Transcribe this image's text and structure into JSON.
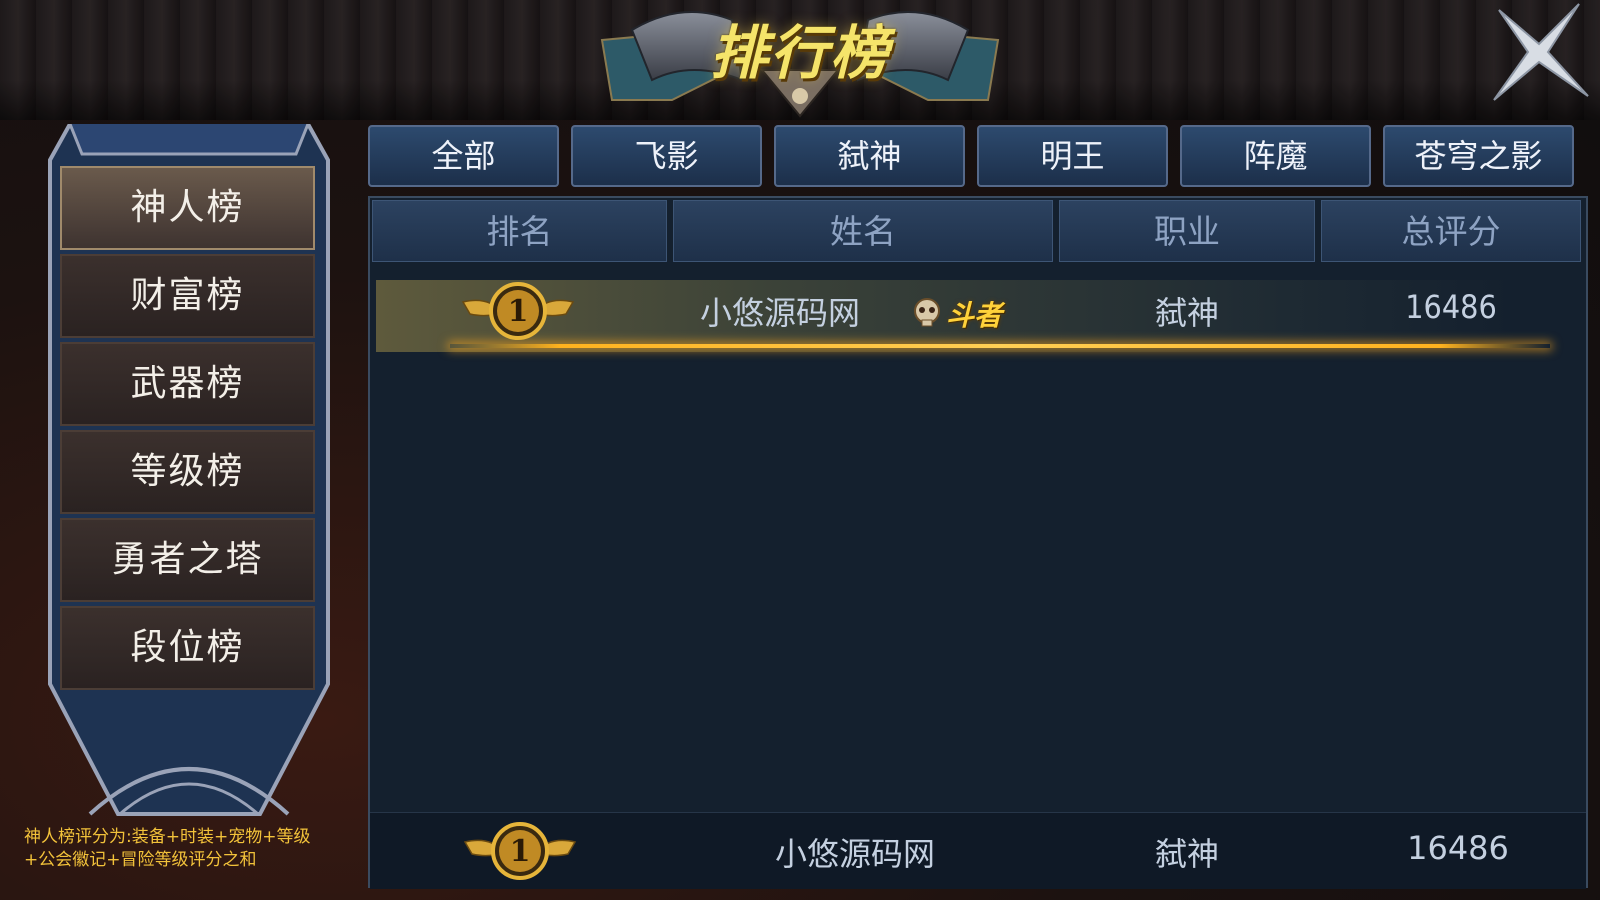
{
  "header": {
    "title": "排行榜"
  },
  "sidebar": {
    "items": [
      {
        "label": "神人榜",
        "active": true
      },
      {
        "label": "财富榜"
      },
      {
        "label": "武器榜"
      },
      {
        "label": "等级榜"
      },
      {
        "label": "勇者之塔"
      },
      {
        "label": "段位榜"
      }
    ],
    "note_line1": "神人榜评分为:装备+时装+宠物+等级",
    "note_line2": "+公会徽记+冒险等级评分之和"
  },
  "tabs": [
    "全部",
    "飞影",
    "弑神",
    "明王",
    "阵魔",
    "苍穹之影"
  ],
  "table": {
    "headers": [
      "排名",
      "姓名",
      "职业",
      "总评分"
    ],
    "rows": [
      {
        "rank": "1",
        "name": "小悠源码网",
        "title_tag": "斗者",
        "job": "弑神",
        "score": "16486"
      }
    ]
  },
  "my_rank": {
    "rank": "1",
    "name": "小悠源码网",
    "job": "弑神",
    "score": "16486"
  },
  "colors": {
    "accent": "#f5e46a",
    "panel": "#14202e",
    "tab": "#2d4a6e",
    "note": "#f2c23a"
  }
}
